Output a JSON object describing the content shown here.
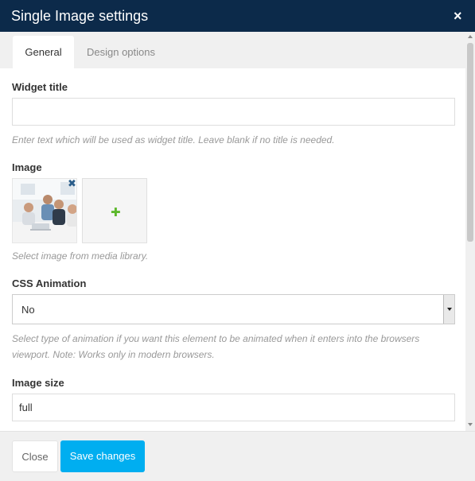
{
  "dialog": {
    "title": "Single Image settings",
    "close_glyph": "×"
  },
  "tabs": [
    {
      "label": "General",
      "active": true
    },
    {
      "label": "Design options",
      "active": false
    }
  ],
  "fields": {
    "widget_title": {
      "label": "Widget title",
      "value": "",
      "help": "Enter text which will be used as widget title. Leave blank if no title is needed."
    },
    "image": {
      "label": "Image",
      "remove_glyph": "✖",
      "add_glyph": "✚",
      "help": "Select image from media library."
    },
    "css_animation": {
      "label": "CSS Animation",
      "value": "No",
      "help": "Select type of animation if you want this element to be animated when it enters into the browsers viewport. Note: Works only in modern browsers."
    },
    "image_size": {
      "label": "Image size",
      "value": "full"
    }
  },
  "footer": {
    "close_label": "Close",
    "save_label": "Save changes"
  },
  "colors": {
    "titlebar": "#0c2a4a",
    "primary_button": "#00aef0",
    "add_icon": "#5cb82b",
    "remove_icon": "#2a5d8a"
  },
  "icons": {
    "close": "close-icon",
    "remove_image": "remove-image-icon",
    "add_image": "plus-icon",
    "dropdown": "chevron-down-icon"
  }
}
